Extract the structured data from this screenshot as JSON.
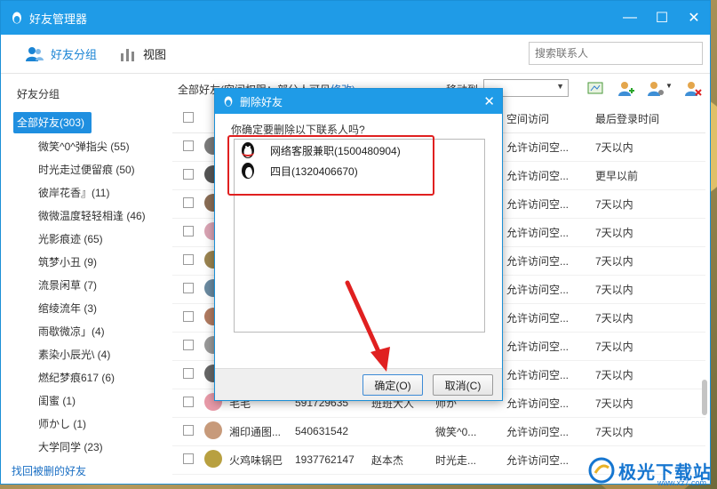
{
  "window": {
    "title": "好友管理器"
  },
  "toolbar": {
    "tab_groups": "好友分组",
    "tab_view": "视图",
    "search_placeholder": "搜索联系人"
  },
  "sidebar": {
    "header": "好友分组",
    "groups": [
      {
        "label": "全部好友(303)"
      },
      {
        "label": "微笑^0^弹指尖 (55)"
      },
      {
        "label": "时光走过便留痕 (50)"
      },
      {
        "label": "彼岸花香』(11)"
      },
      {
        "label": "微微温度轻轻相逢 (46)"
      },
      {
        "label": "光影痕迹 (65)"
      },
      {
        "label": "筑梦小丑 (9)"
      },
      {
        "label": "流景闲草 (7)"
      },
      {
        "label": "绾绫流年 (3)"
      },
      {
        "label": "雨歇微凉」(4)"
      },
      {
        "label": "素染小辰光\\ (4)"
      },
      {
        "label": "燃纪梦痕617 (6)"
      },
      {
        "label": "闺蜜 (1)"
      },
      {
        "label": "师かし (1)"
      },
      {
        "label": "大学同学 (23)"
      }
    ],
    "recover_link": "找回被删的好友"
  },
  "main": {
    "header_text": "全部好友(空间权限：部分人可见",
    "header_link": "修改)",
    "move_to_label": "移动到",
    "columns": {
      "space": "空间访问",
      "last_login": "最后登录时间"
    },
    "rows": [
      {
        "name": "",
        "qq": "",
        "remark": "",
        "sig": "",
        "space": "允许访问空...",
        "last": "7天以内",
        "av": "#7b7b7b"
      },
      {
        "name": "",
        "qq": "",
        "remark": "",
        "sig": "",
        "space": "允许访问空...",
        "last": "更早以前",
        "av": "#555"
      },
      {
        "name": "",
        "qq": "",
        "remark": "",
        "sig": "",
        "space": "允许访问空...",
        "last": "7天以内",
        "av": "#8a6d55"
      },
      {
        "name": "",
        "qq": "",
        "remark": "",
        "sig": "",
        "space": "允许访问空...",
        "last": "7天以内",
        "av": "#d9a3b3"
      },
      {
        "name": "",
        "qq": "",
        "remark": "",
        "sig": "",
        "space": "允许访问空...",
        "last": "7天以内",
        "av": "#9a8450"
      },
      {
        "name": "",
        "qq": "",
        "remark": "",
        "sig": "",
        "space": "允许访问空...",
        "last": "7天以内",
        "av": "#6a8aa0"
      },
      {
        "name": "",
        "qq": "",
        "remark": "",
        "sig": "",
        "space": "允许访问空...",
        "last": "7天以内",
        "av": "#b07a60"
      },
      {
        "name": "",
        "qq": "",
        "remark": "",
        "sig": "",
        "space": "允许访问空...",
        "last": "7天以内",
        "av": "#999"
      },
      {
        "name": "",
        "qq": "",
        "remark": "",
        "sig": "",
        "space": "允许访问空...",
        "last": "7天以内",
        "av": "#666"
      },
      {
        "name": "毛毛",
        "qq": "591729635",
        "remark": "班班大人",
        "sig": "师か",
        "space": "允许访问空...",
        "last": "7天以内",
        "av": "#e89aa8"
      },
      {
        "name": "湘印通图...",
        "qq": "540631542",
        "remark": "",
        "sig": "微笑^0...",
        "space": "允许访问空...",
        "last": "7天以内",
        "av": "#c79a7a"
      },
      {
        "name": "火鸡味锅巴",
        "qq": "1937762147",
        "remark": "赵本杰",
        "sig": "时光走...",
        "space": "允许访问空...",
        "last": "",
        "av": "#b8a040"
      }
    ]
  },
  "dialog": {
    "title": "删除好友",
    "prompt": "你确定要删除以下联系人吗?",
    "items": [
      {
        "label": "网络客服兼职(1500480904)"
      },
      {
        "label": "四目(1320406670)"
      }
    ],
    "ok_label": "确定(O)",
    "cancel_label": "取消(C)"
  },
  "watermark": {
    "text": "极光下载站",
    "url": "www.xz7.com"
  },
  "colors": {
    "titlebar": "#1f9be7",
    "selected": "#1f8fe0",
    "highlight": "#e02020",
    "link": "#1a6fc4"
  }
}
